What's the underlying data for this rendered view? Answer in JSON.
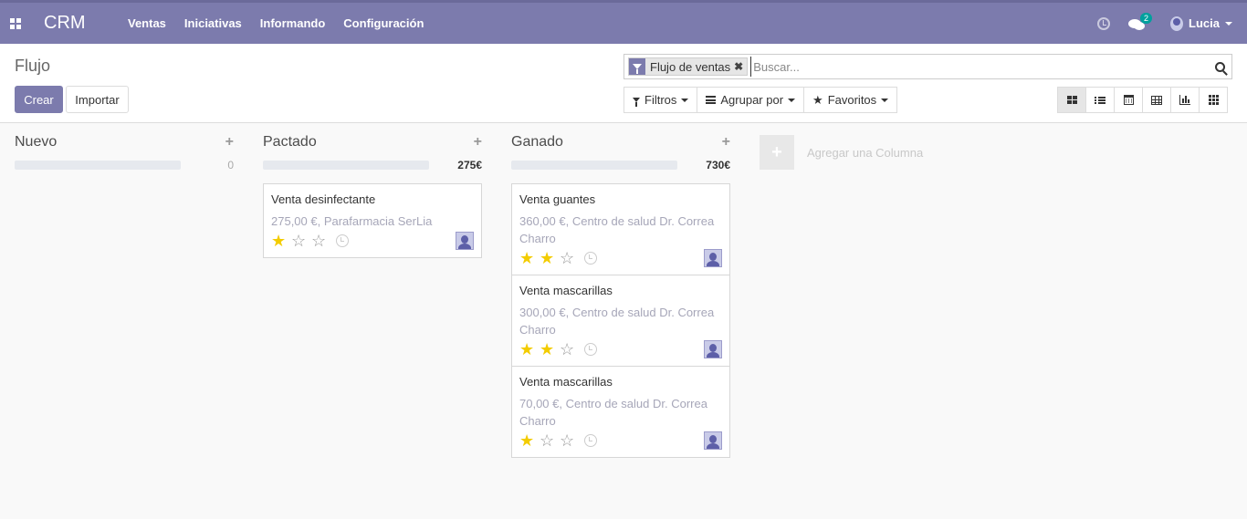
{
  "topbar": {
    "brand": "CRM",
    "menu": [
      "Ventas",
      "Iniciativas",
      "Informando",
      "Configuración"
    ],
    "chat_count": "2",
    "user_name": "Lucia"
  },
  "control": {
    "breadcrumb": "Flujo",
    "create_label": "Crear",
    "import_label": "Importar",
    "search": {
      "facet": "Flujo de ventas",
      "placeholder": "Buscar..."
    },
    "filters_label": "Filtros",
    "groupby_label": "Agrupar por",
    "favorites_label": "Favoritos"
  },
  "kanban": {
    "columns": [
      {
        "title": "Nuevo",
        "total": "0",
        "cards": []
      },
      {
        "title": "Pactado",
        "total": "275€",
        "cards": [
          {
            "title": "Venta desinfectante",
            "subtitle": "275,00 €, Parafarmacia SerLia",
            "stars": 1
          }
        ]
      },
      {
        "title": "Ganado",
        "total": "730€",
        "cards": [
          {
            "title": "Venta guantes",
            "subtitle": "360,00 €, Centro de salud Dr. Correa Charro",
            "stars": 2
          },
          {
            "title": "Venta mascarillas",
            "subtitle": "300,00 €, Centro de salud Dr. Correa Charro",
            "stars": 2
          },
          {
            "title": "Venta mascarillas",
            "subtitle": "70,00 €, Centro de salud Dr. Correa Charro",
            "stars": 1
          }
        ]
      }
    ],
    "add_column_label": "Agregar una Columna"
  },
  "colors": {
    "brand": "#7c7bad",
    "star_on": "#f3cc00"
  }
}
